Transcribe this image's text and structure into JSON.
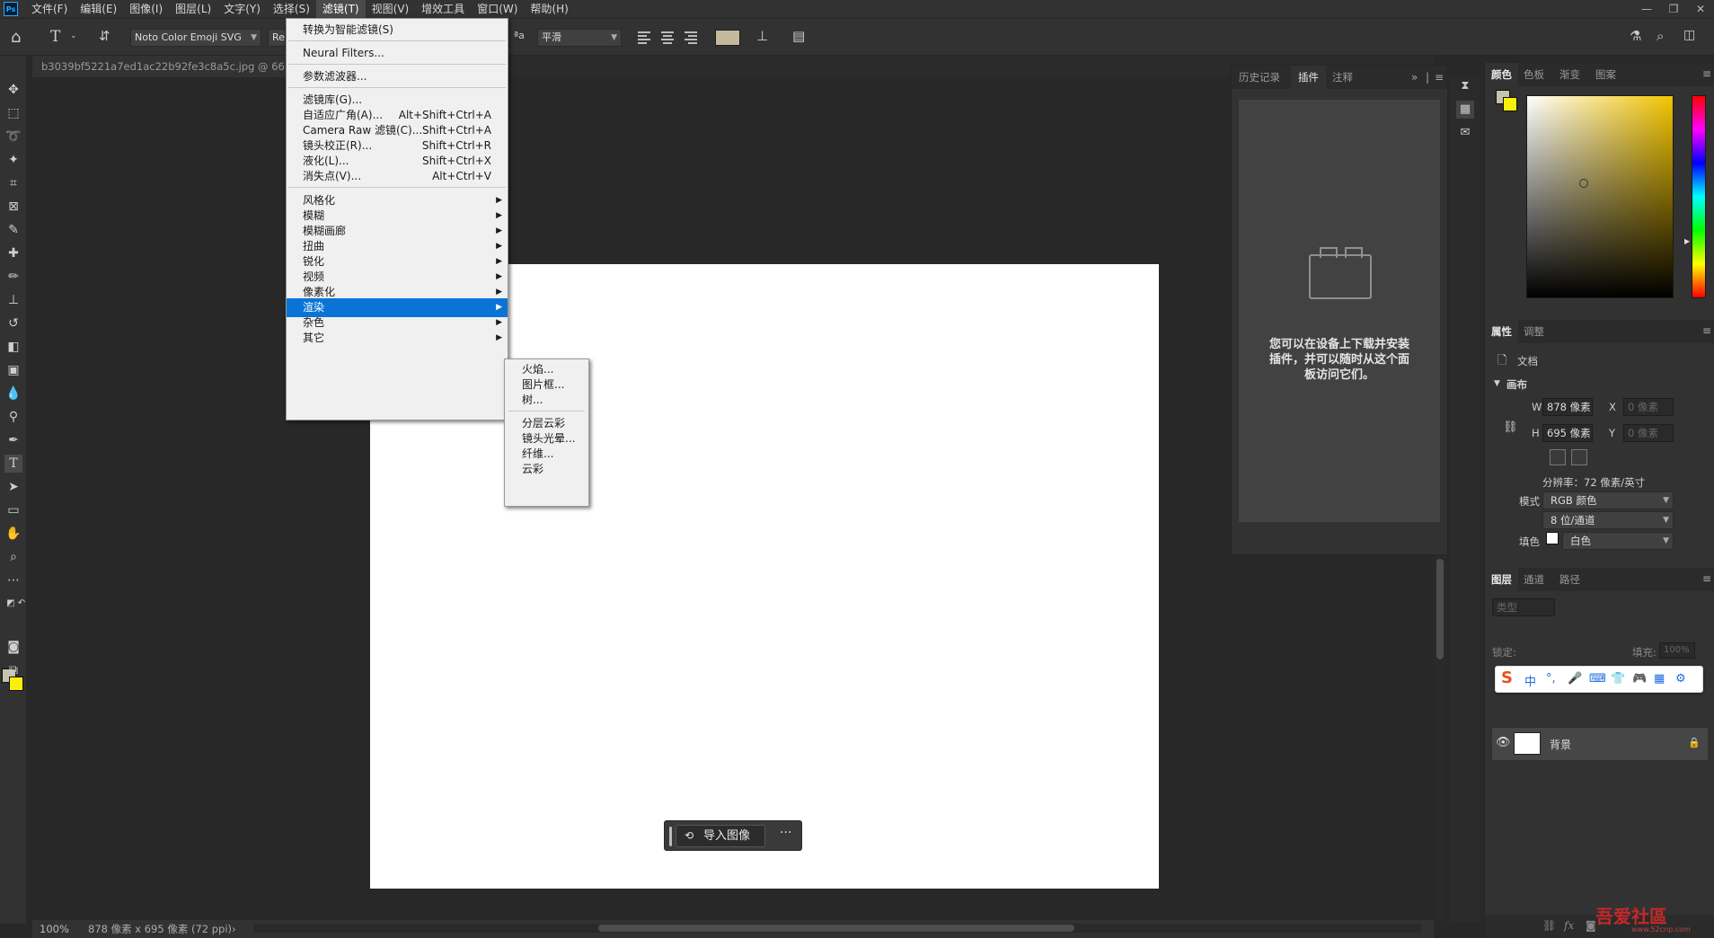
{
  "menubar": {
    "logo": "Ps",
    "items": [
      "文件(F)",
      "编辑(E)",
      "图像(I)",
      "图层(L)",
      "文字(Y)",
      "选择(S)",
      "滤镜(T)",
      "视图(V)",
      "增效工具",
      "窗口(W)",
      "帮助(H)"
    ],
    "active_index": 6
  },
  "optionsbar": {
    "font_family": "Noto Color Emoji SVG",
    "font_style_partial": "Re",
    "antialias": "平滑",
    "text_color": "#c4b99a"
  },
  "document": {
    "tab_title": "b3039bf5221a7ed1ac22b92fe3c8a5c.jpg @ 66.7%(R",
    "canvas_color": "#ffffff"
  },
  "filter_menu": {
    "items": [
      {
        "label": "转换为智能滤镜(S)",
        "shortcut": ""
      },
      {
        "label": "Neural Filters...",
        "shortcut": ""
      },
      {
        "label": "参数滤波器...",
        "shortcut": ""
      },
      {
        "label": "滤镜库(G)...",
        "shortcut": ""
      },
      {
        "label": "自适应广角(A)...",
        "shortcut": "Alt+Shift+Ctrl+A"
      },
      {
        "label": "Camera Raw 滤镜(C)...",
        "shortcut": "Shift+Ctrl+A"
      },
      {
        "label": "镜头校正(R)...",
        "shortcut": "Shift+Ctrl+R"
      },
      {
        "label": "液化(L)...",
        "shortcut": "Shift+Ctrl+X"
      },
      {
        "label": "消失点(V)...",
        "shortcut": "Alt+Ctrl+V"
      },
      {
        "label": "风格化",
        "shortcut": ""
      },
      {
        "label": "模糊",
        "shortcut": ""
      },
      {
        "label": "模糊画廊",
        "shortcut": ""
      },
      {
        "label": "扭曲",
        "shortcut": ""
      },
      {
        "label": "锐化",
        "shortcut": ""
      },
      {
        "label": "视频",
        "shortcut": ""
      },
      {
        "label": "像素化",
        "shortcut": ""
      },
      {
        "label": "渲染",
        "shortcut": ""
      },
      {
        "label": "杂色",
        "shortcut": ""
      },
      {
        "label": "其它",
        "shortcut": ""
      }
    ],
    "highlight_color": "#0a74d6"
  },
  "render_submenu": {
    "items": [
      "火焰...",
      "图片框...",
      "树...",
      "分层云彩",
      "镜头光晕...",
      "纤维...",
      "云彩"
    ]
  },
  "context_bar": {
    "import_label": "导入图像",
    "more_label": "···"
  },
  "statusbar": {
    "zoom": "100%",
    "doc_info": "878 像素 x 695 像素 (72 ppi)",
    "arrow": "›"
  },
  "plugins_panel": {
    "tabs": [
      "历史记录",
      "插件",
      "注释"
    ],
    "active_tab": 1,
    "message": "您可以在设备上下载并安装插件，并可以随时从这个面板访问它们。"
  },
  "color_panel": {
    "tabs": [
      "颜色",
      "色板",
      "渐变",
      "图案"
    ],
    "fg_color": "#c8c3ae",
    "bg_color": "#f8f008"
  },
  "properties_panel": {
    "tabs": [
      "属性",
      "调整"
    ],
    "doc_label": "文档",
    "section": "画布",
    "w_label": "W",
    "w_value": "878 像素",
    "h_label": "H",
    "h_value": "695 像素",
    "x_label": "X",
    "x_placeholder": "0 像素",
    "y_label": "Y",
    "y_placeholder": "0 像素",
    "resolution": "分辨率：72 像素/英寸",
    "mode_label": "模式",
    "mode_value": "RGB 颜色",
    "depth_value": "8 位/通道",
    "fill_label": "填色",
    "fill_value": "白色"
  },
  "layers_panel": {
    "tabs": [
      "图层",
      "通道",
      "路径"
    ],
    "kind_placeholder": "类型",
    "lock_label": "锁定:",
    "fill_label": "填充:",
    "fill_value": "100%",
    "layer_name": "背景"
  },
  "ime_bar": {
    "logo": "S",
    "lang": "中"
  },
  "watermark": {
    "text": "吾爱社區",
    "site": "www.52cnp.com"
  }
}
